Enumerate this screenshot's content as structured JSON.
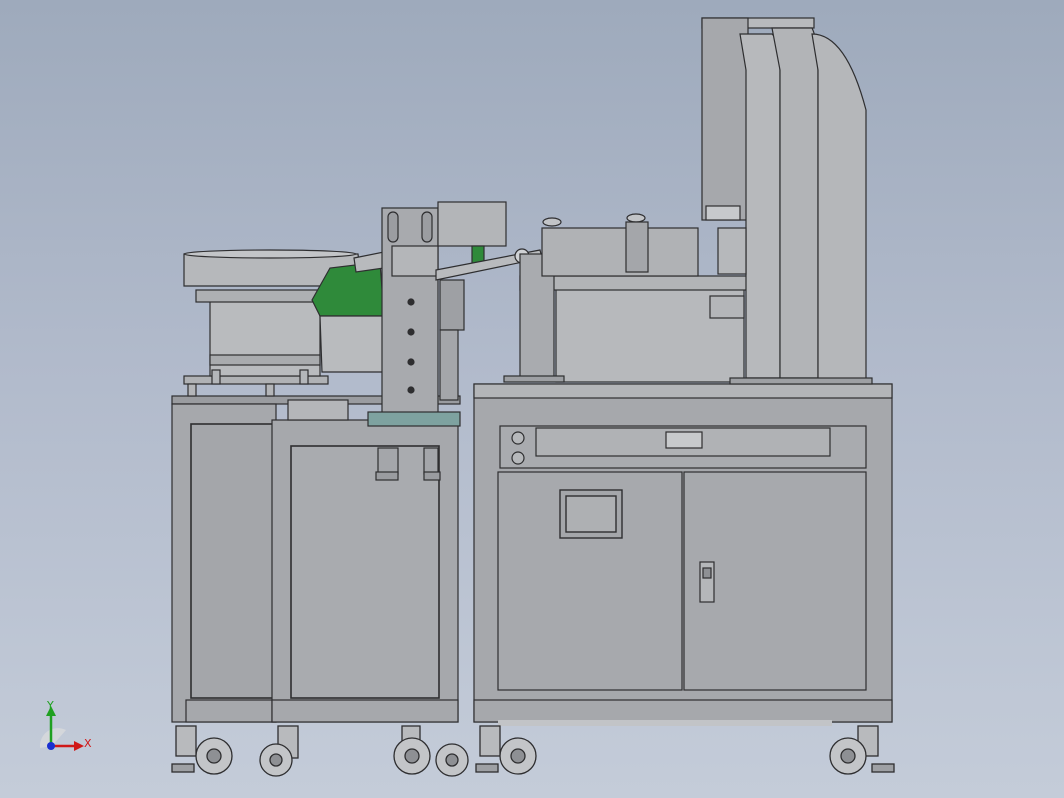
{
  "viewport": {
    "background_top": "#9eaabc",
    "background_bottom": "#c4ccd9"
  },
  "palette": {
    "cabinet": "#a6a8ac",
    "cabinet_dark": "#8f9195",
    "panel": "#b5b7ba",
    "outline": "#2e2e30",
    "bowl_green": "#2f8a3a",
    "axis_x": "#d01818",
    "axis_y": "#1fa020",
    "axis_z": "#1a2fd0"
  },
  "triad": {
    "x_label": "X",
    "y_label": "Y",
    "icon": "coordinate-triad-icon"
  },
  "model": {
    "icons": [
      "vibratory-bowl-feeder-icon",
      "assembly-turntable-icon",
      "hmi-touchscreen-icon",
      "door-lock-icon",
      "caster-wheel-icon",
      "push-button-icon"
    ]
  }
}
